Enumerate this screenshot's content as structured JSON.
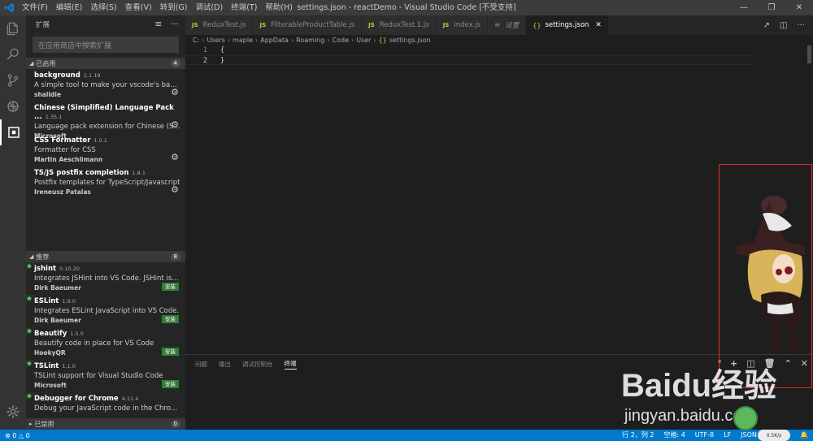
{
  "titlebar": {
    "menu": [
      "文件(F)",
      "编辑(E)",
      "选择(S)",
      "查看(V)",
      "转到(G)",
      "调试(D)",
      "终端(T)",
      "帮助(H)"
    ],
    "title": "settings.json - reactDemo - Visual Studio Code [不受支持]"
  },
  "sidebar": {
    "title": "扩展",
    "search_placeholder": "在应用商店中搜索扩展",
    "enabled": {
      "label": "已启用",
      "count": "4",
      "items": [
        {
          "name": "background",
          "version": "1.1.19",
          "description": "A simple tool to make your vscode's backgro...",
          "publisher": "shalldie"
        },
        {
          "name": "Chinese (Simplified) Language Pack ...",
          "version": "1.35.1",
          "description": "Language pack extension for Chinese (Simplifi...",
          "publisher": "Microsoft"
        },
        {
          "name": "CSS Formatter",
          "version": "1.0.1",
          "description": "Formatter for CSS",
          "publisher": "Martin Aeschlimann"
        },
        {
          "name": "TS/JS postfix completion",
          "version": "1.8.1",
          "description": "Postfix templates for TypeScript/Javascript",
          "publisher": "Ireneusz Patalas"
        }
      ]
    },
    "recommended": {
      "label": "推荐",
      "count": "8",
      "install_label": "安装",
      "items": [
        {
          "name": "jshint",
          "version": "0.10.20",
          "description": "Integrates JSHint into VS Code. JSHint is a lint...",
          "publisher": "Dirk Baeumer"
        },
        {
          "name": "ESLint",
          "version": "1.9.0",
          "description": "Integrates ESLint JavaScript into VS Code.",
          "publisher": "Dirk Baeumer"
        },
        {
          "name": "Beautify",
          "version": "1.5.0",
          "description": "Beautify code in place for VS Code",
          "publisher": "HookyQR"
        },
        {
          "name": "TSLint",
          "version": "1.1.0",
          "description": "TSLint support for Visual Studio Code",
          "publisher": "Microsoft"
        },
        {
          "name": "Debugger for Chrome",
          "version": "4.11.4",
          "description": "Debug your JavaScript code in the Chrome br...",
          "publisher": ""
        }
      ]
    },
    "disabled": {
      "label": "已禁用",
      "count": "0"
    }
  },
  "tabs": [
    {
      "label": "ReduxTest.js",
      "type": "js"
    },
    {
      "label": "FilterableProductTable.js",
      "type": "js"
    },
    {
      "label": "ReduxTest.1.js",
      "type": "js"
    },
    {
      "label": "index.js",
      "type": "js"
    },
    {
      "label": "设置",
      "type": "settings"
    },
    {
      "label": "settings.json",
      "type": "json"
    }
  ],
  "breadcrumb": [
    "C:",
    "Users",
    "maple",
    "AppData",
    "Roaming",
    "Code",
    "User",
    "settings.json"
  ],
  "editor": {
    "lines": [
      {
        "num": "1",
        "code": "{"
      },
      {
        "num": "2",
        "code": "}"
      }
    ]
  },
  "panel": {
    "tabs": [
      "问题",
      "输出",
      "调试控制台",
      "终端"
    ]
  },
  "statusbar": {
    "errors": "0",
    "warnings": "0",
    "position": "行 2，列 2",
    "spaces": "空格: 4",
    "encoding": "UTF-8",
    "eol": "LF",
    "language": "JSON w",
    "net_speed": "0.5K/s"
  },
  "watermark": {
    "text": "Baidu经验",
    "url": "jingyan.baidu.com"
  },
  "colors": {
    "statusbar": "#007acc",
    "install": "#327e36",
    "frame": "#e12b2b",
    "js": "#cbcb41"
  }
}
